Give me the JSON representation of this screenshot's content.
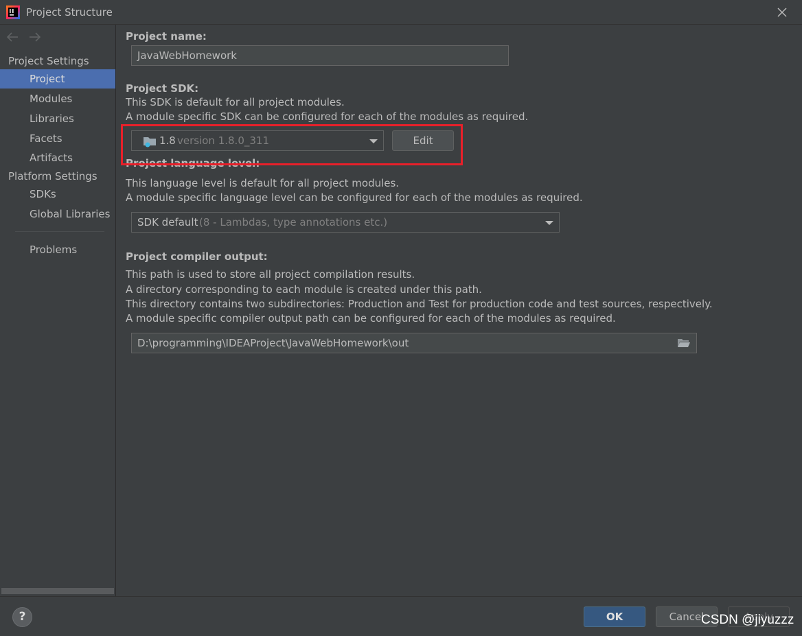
{
  "window": {
    "title": "Project Structure"
  },
  "sidebar": {
    "project_settings_label": "Project Settings",
    "project_settings_items": [
      {
        "label": "Project",
        "selected": true
      },
      {
        "label": "Modules",
        "selected": false
      },
      {
        "label": "Libraries",
        "selected": false
      },
      {
        "label": "Facets",
        "selected": false
      },
      {
        "label": "Artifacts",
        "selected": false
      }
    ],
    "platform_settings_label": "Platform Settings",
    "platform_settings_items": [
      {
        "label": "SDKs"
      },
      {
        "label": "Global Libraries"
      }
    ],
    "problems_label": "Problems"
  },
  "project": {
    "name_label": "Project name:",
    "name_value": "JavaWebHomework",
    "sdk_label": "Project SDK:",
    "sdk_desc_1": "This SDK is default for all project modules.",
    "sdk_desc_2": "A module specific SDK can be configured for each of the modules as required.",
    "sdk_selected_name": "1.8",
    "sdk_selected_version": "version 1.8.0_311",
    "sdk_edit_label": "Edit",
    "language_label": "Project language level:",
    "language_desc_1": "This language level is default for all project modules.",
    "language_desc_2": "A module specific language level can be configured for each of the modules as required.",
    "language_selected": "SDK default",
    "language_selected_hint": "(8 - Lambdas, type annotations etc.)",
    "compiler_label": "Project compiler output:",
    "compiler_desc_1": "This path is used to store all project compilation results.",
    "compiler_desc_2": "A directory corresponding to each module is created under this path.",
    "compiler_desc_3": "This directory contains two subdirectories: Production and Test for production code and test sources, respectively.",
    "compiler_desc_4": "A module specific compiler output path can be configured for each of the modules as required.",
    "compiler_output_path": "D:\\programming\\IDEAProject\\JavaWebHomework\\out"
  },
  "footer": {
    "help_label": "?",
    "ok_label": "OK",
    "cancel_label": "Cancel",
    "apply_label": "Apply"
  },
  "watermark": "CSDN @jiyuzzz",
  "colors": {
    "background": "#3c3f41",
    "selection": "#4b6eaf",
    "primary_button": "#365880",
    "highlight_box": "#e8202a"
  }
}
